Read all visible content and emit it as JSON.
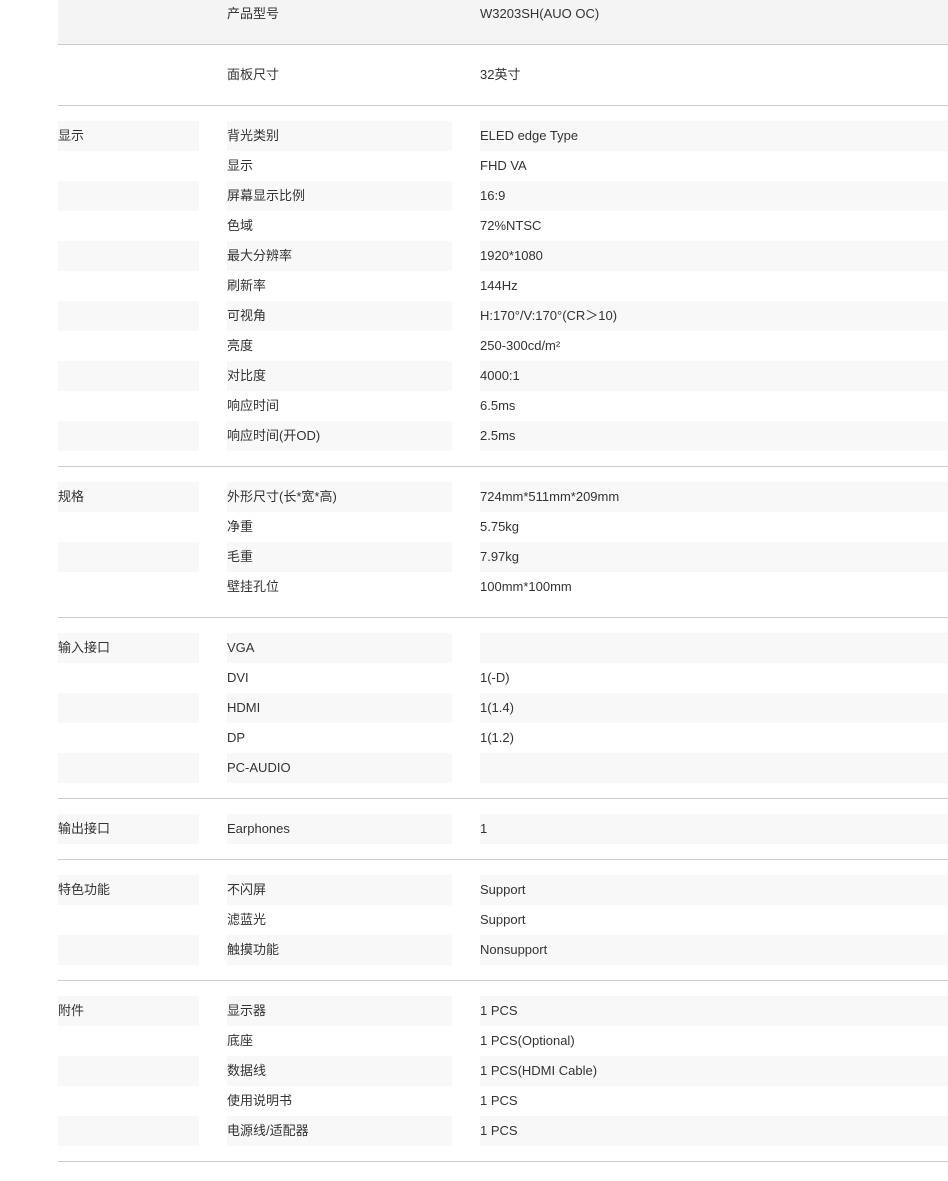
{
  "header_rows": [
    {
      "label": "产品型号",
      "value": "W3203SH(AUO OC)"
    },
    {
      "label": "面板尺寸",
      "value": "32英寸"
    }
  ],
  "groups": [
    {
      "name": "显示",
      "rows": [
        {
          "label": "背光类别",
          "value": "ELED edge Type"
        },
        {
          "label": "显示",
          "value": "FHD VA"
        },
        {
          "label": "屏幕显示比例",
          "value": "16:9"
        },
        {
          "label": "色域",
          "value": "72%NTSC"
        },
        {
          "label": "最大分辨率",
          "value": "1920*1080"
        },
        {
          "label": "刷新率",
          "value": "144Hz"
        },
        {
          "label": "可视角",
          "value": "H:170°/V:170°(CR＞10)"
        },
        {
          "label": "亮度",
          "value": "250-300cd/m²"
        },
        {
          "label": "对比度",
          "value": "4000:1"
        },
        {
          "label": "响应时间",
          "value": "6.5ms"
        },
        {
          "label": "响应时间(开OD)",
          "value": "2.5ms"
        }
      ]
    },
    {
      "name": "规格",
      "rows": [
        {
          "label": "外形尺寸(长*宽*高)",
          "value": "724mm*511mm*209mm"
        },
        {
          "label": "净重",
          "value": "5.75kg"
        },
        {
          "label": "毛重",
          "value": "7.97kg"
        },
        {
          "label": "壁挂孔位",
          "value": "100mm*100mm"
        }
      ]
    },
    {
      "name": "输入接口",
      "rows": [
        {
          "label": "VGA",
          "value": ""
        },
        {
          "label": "DVI",
          "value": "1(-D)"
        },
        {
          "label": "HDMI",
          "value": "1(1.4)"
        },
        {
          "label": "DP",
          "value": "1(1.2)"
        },
        {
          "label": "PC-AUDIO",
          "value": ""
        }
      ]
    },
    {
      "name": "输出接口",
      "rows": [
        {
          "label": "Earphones",
          "value": "1"
        }
      ]
    },
    {
      "name": "特色功能",
      "rows": [
        {
          "label": "不闪屏",
          "value": "Support"
        },
        {
          "label": "滤蓝光",
          "value": "Support"
        },
        {
          "label": "触摸功能",
          "value": "Nonsupport"
        }
      ]
    },
    {
      "name": "附件",
      "rows": [
        {
          "label": "显示器",
          "value": "1 PCS"
        },
        {
          "label": "底座",
          "value": "1 PCS(Optional)"
        },
        {
          "label": "数据线",
          "value": "1 PCS(HDMI Cable)"
        },
        {
          "label": "使用说明书",
          "value": "1 PCS"
        },
        {
          "label": "电源线/适配器",
          "value": "1 PCS"
        }
      ]
    }
  ]
}
